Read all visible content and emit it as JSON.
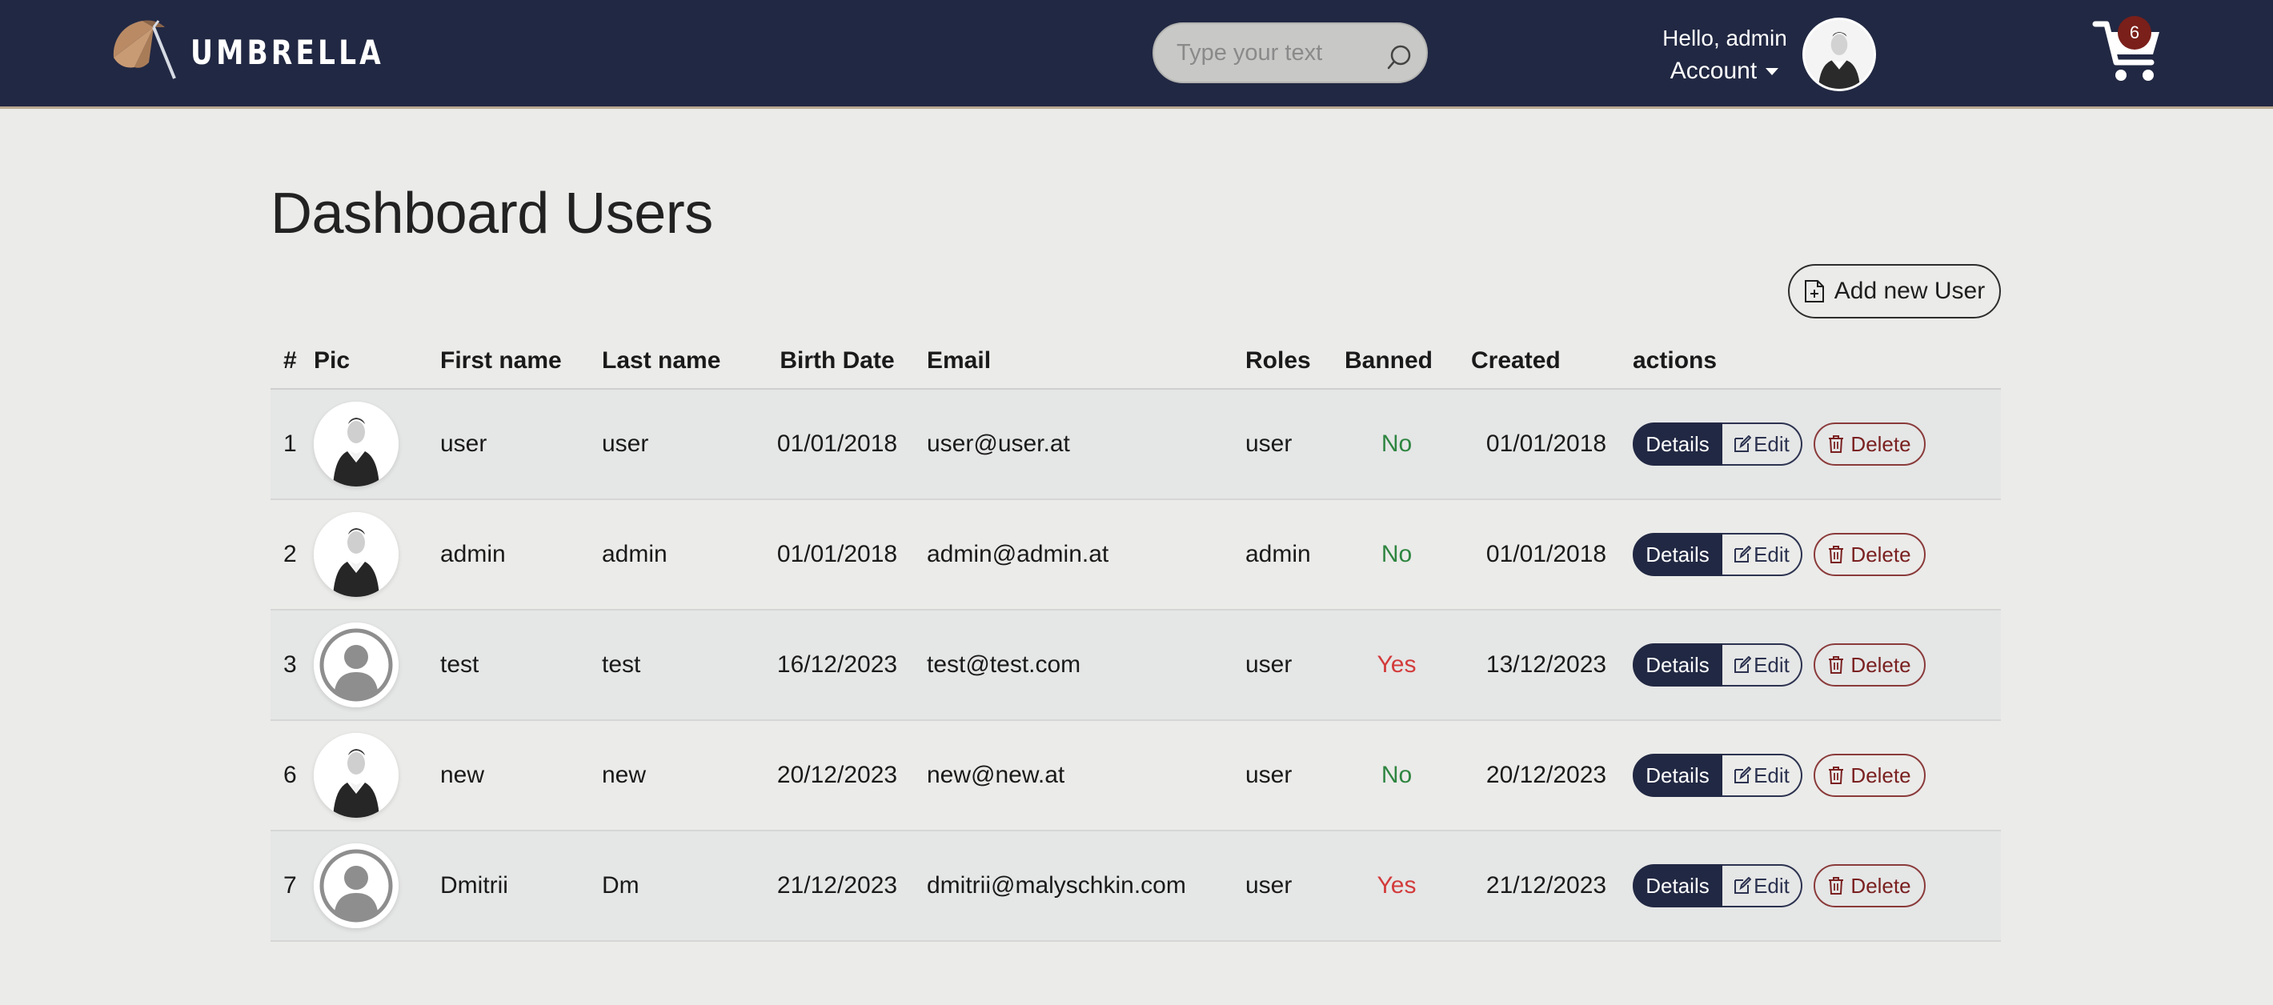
{
  "header": {
    "brand": "UMBRELLA",
    "search": {
      "placeholder": "Type your text",
      "value": ""
    },
    "greeting": "Hello, admin",
    "account_label": "Account",
    "cart_count": "6"
  },
  "page": {
    "title": "Dashboard Users",
    "add_button_label": "Add new User"
  },
  "table": {
    "columns": [
      "#",
      "Pic",
      "First name",
      "Last name",
      "Birth Date",
      "Email",
      "Roles",
      "Banned",
      "Created",
      "actions"
    ],
    "rows": [
      {
        "id": "1",
        "avatar": "portrait",
        "first": "user",
        "last": "user",
        "birth": "01/01/2018",
        "email": "user@user.at",
        "roles": "user",
        "banned": "No",
        "created": "01/01/2018"
      },
      {
        "id": "2",
        "avatar": "portrait",
        "first": "admin",
        "last": "admin",
        "birth": "01/01/2018",
        "email": "admin@admin.at",
        "roles": "admin",
        "banned": "No",
        "created": "01/01/2018"
      },
      {
        "id": "3",
        "avatar": "default",
        "first": "test",
        "last": "test",
        "birth": "16/12/2023",
        "email": "test@test.com",
        "roles": "user",
        "banned": "Yes",
        "created": "13/12/2023"
      },
      {
        "id": "6",
        "avatar": "portrait",
        "first": "new",
        "last": "new",
        "birth": "20/12/2023",
        "email": "new@new.at",
        "roles": "user",
        "banned": "No",
        "created": "20/12/2023"
      },
      {
        "id": "7",
        "avatar": "default",
        "first": "Dmitrii",
        "last": "Dm",
        "birth": "21/12/2023",
        "email": "dmitrii@malyschkin.com",
        "roles": "user",
        "banned": "Yes",
        "created": "21/12/2023"
      }
    ],
    "actions": {
      "details": "Details",
      "edit": "Edit",
      "delete": "Delete"
    }
  },
  "colors": {
    "header_bg": "#212843",
    "page_bg": "#ebebe9",
    "banned_no": "#2e8540",
    "banned_yes": "#d33b3b",
    "cart_badge": "#7a1f1a"
  },
  "icons": {
    "logo": "umbrella-icon",
    "search": "search-icon",
    "caret": "caret-down-icon",
    "cart": "cart-icon",
    "add": "file-plus-icon",
    "edit": "edit-icon",
    "delete": "trash-icon"
  }
}
